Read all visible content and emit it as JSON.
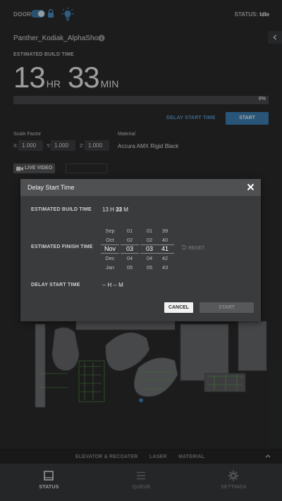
{
  "topbar": {
    "door_label": "DOOR",
    "door_toggle_on": true,
    "lock_icon": "lock-icon",
    "light_icon": "lightbulb-icon",
    "status_label": "STATUS:",
    "status_value": "Idle"
  },
  "job": {
    "name": "Panther_Kodiak_AlphaShort",
    "info_icon": "info-icon",
    "collapse_icon": "chevron-left-icon"
  },
  "build_time": {
    "label": "ESTIMATED BUILD TIME",
    "hours": "13",
    "hours_unit": "HR",
    "minutes": "33",
    "minutes_unit": "MIN"
  },
  "progress": {
    "fraction": 0.0,
    "label": "0%"
  },
  "actions": {
    "delay_start_label": "DELAY START TIME",
    "start_label": "START"
  },
  "settings": {
    "scale_factor_label": "Scale Factor",
    "x_label": "X:",
    "y_label": "Y:",
    "z_label": "Z:",
    "x_value": "1.000",
    "y_value": "1.000",
    "z_value": "1.000",
    "material_label": "Material",
    "material_value": "Accura AMX Rigid Black"
  },
  "view_buttons": {
    "live_video_label": "LIVE VIDEO",
    "camera_icon": "video-camera-icon"
  },
  "modal": {
    "title": "Delay Start Time",
    "close_icon": "close-icon",
    "est_build_label": "ESTIMATED BUILD TIME",
    "est_build_hours": "13",
    "est_build_h": "H",
    "est_build_minutes": "33",
    "est_build_m": "M",
    "finish_label": "ESTIMATED FINISH TIME",
    "picker": {
      "months": [
        "Sep",
        "Oct",
        "Nov",
        "Dec",
        "Jan"
      ],
      "days": [
        "01",
        "02",
        "03",
        "04",
        "05"
      ],
      "hours": [
        "01",
        "02",
        "03",
        "04",
        "05"
      ],
      "minutes": [
        "39",
        "40",
        "41",
        "42",
        "43"
      ],
      "selected_index": 2
    },
    "reset_label": "RESET",
    "reset_icon": "undo-icon",
    "delay_label": "DELAY START TIME",
    "delay_value": "-- H -- M",
    "cancel_label": "CANCEL",
    "start_label": "START"
  },
  "panel_tabs": {
    "items": [
      "ELEVATOR & RECOATER",
      "LASER",
      "MATERIAL"
    ],
    "expand_icon": "chevron-up-icon"
  },
  "nav": {
    "items": [
      {
        "label": "STATUS",
        "icon": "square-icon",
        "active": true
      },
      {
        "label": "QUEUE",
        "icon": "list-icon",
        "active": false
      },
      {
        "label": "SETTINGS",
        "icon": "gear-icon",
        "active": false
      }
    ]
  },
  "colors": {
    "accent": "#3e83b8",
    "link": "#5c9fd2",
    "background": "#2b2c2d",
    "modal": "#3a3b3d"
  }
}
